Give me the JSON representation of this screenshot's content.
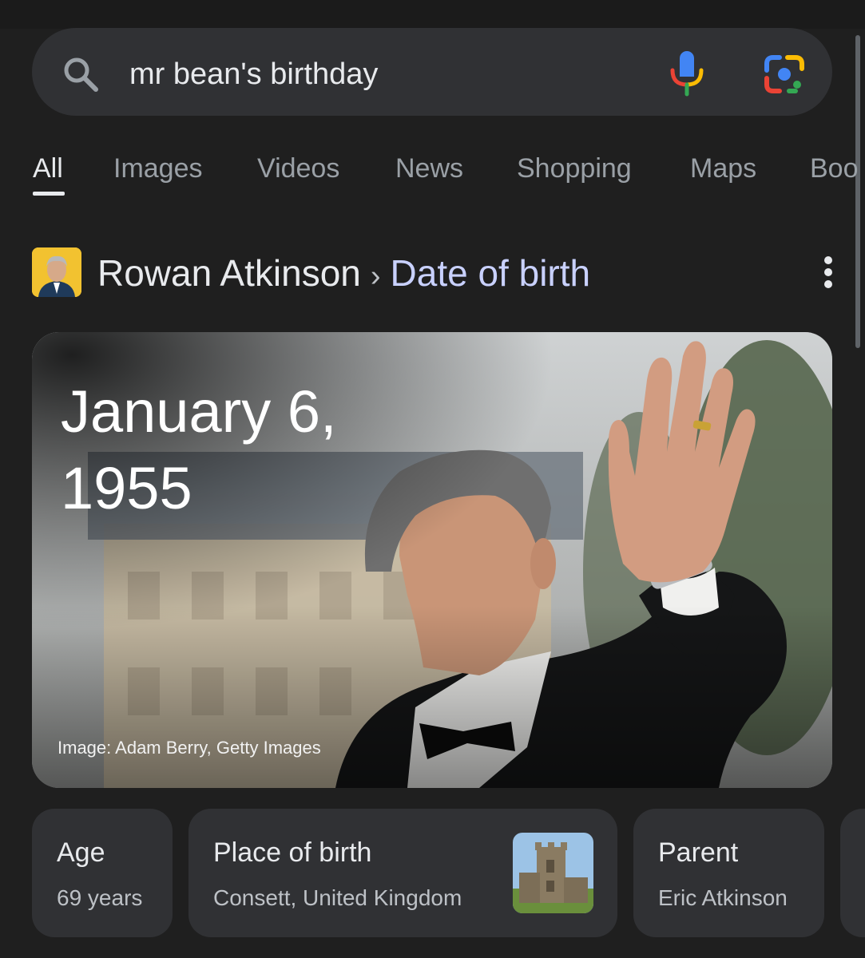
{
  "search": {
    "query": "mr bean's birthday"
  },
  "tabs": [
    {
      "label": "All"
    },
    {
      "label": "Images"
    },
    {
      "label": "Videos"
    },
    {
      "label": "News"
    },
    {
      "label": "Shopping"
    },
    {
      "label": "Maps"
    },
    {
      "label": "Boo"
    }
  ],
  "result": {
    "entity": "Rowan Atkinson",
    "separator": "›",
    "attribute": "Date of birth",
    "date_line1": "January 6,",
    "date_line2": "1955",
    "image_credit": "Image: Adam Berry, Getty Images"
  },
  "facts": [
    {
      "label": "Age",
      "value": "69 years"
    },
    {
      "label": "Place of birth",
      "value": "Consett, United Kingdom"
    },
    {
      "label": "Parent",
      "value": "Eric Atkinson"
    }
  ],
  "colors": {
    "background": "#1f1f1f",
    "surface": "#303134",
    "accent_attribute": "#c9d1ff"
  }
}
